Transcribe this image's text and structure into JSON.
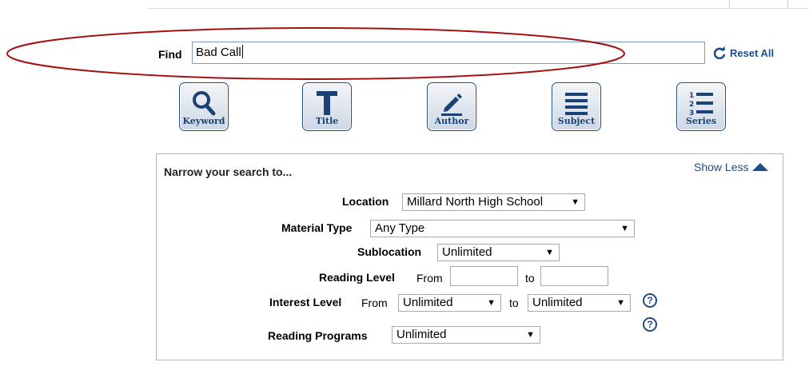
{
  "search": {
    "label": "Find",
    "value": "Bad Call",
    "reset_label": "Reset All"
  },
  "search_buttons": [
    {
      "label": "Keyword",
      "icon": "magnifier-icon"
    },
    {
      "label": "Title",
      "icon": "title-t-icon"
    },
    {
      "label": "Author",
      "icon": "pencil-icon"
    },
    {
      "label": "Subject",
      "icon": "lines-icon"
    },
    {
      "label": "Series",
      "icon": "numbered-list-icon"
    }
  ],
  "narrow": {
    "title": "Narrow your search to...",
    "toggle_label": "Show Less",
    "location": {
      "label": "Location",
      "value": "Millard North High School"
    },
    "material_type": {
      "label": "Material Type",
      "value": "Any Type"
    },
    "sublocation": {
      "label": "Sublocation",
      "value": "Unlimited"
    },
    "reading_level": {
      "label": "Reading Level",
      "from": "From",
      "to": "to"
    },
    "interest_level": {
      "label": "Interest Level",
      "from": "From",
      "from_value": "Unlimited",
      "to": "to",
      "to_value": "Unlimited"
    },
    "reading_programs": {
      "label": "Reading Programs",
      "value": "Unlimited"
    },
    "help_glyph": "?"
  },
  "colors": {
    "accent": "#1a4f8c",
    "annotation": "#a31212"
  }
}
